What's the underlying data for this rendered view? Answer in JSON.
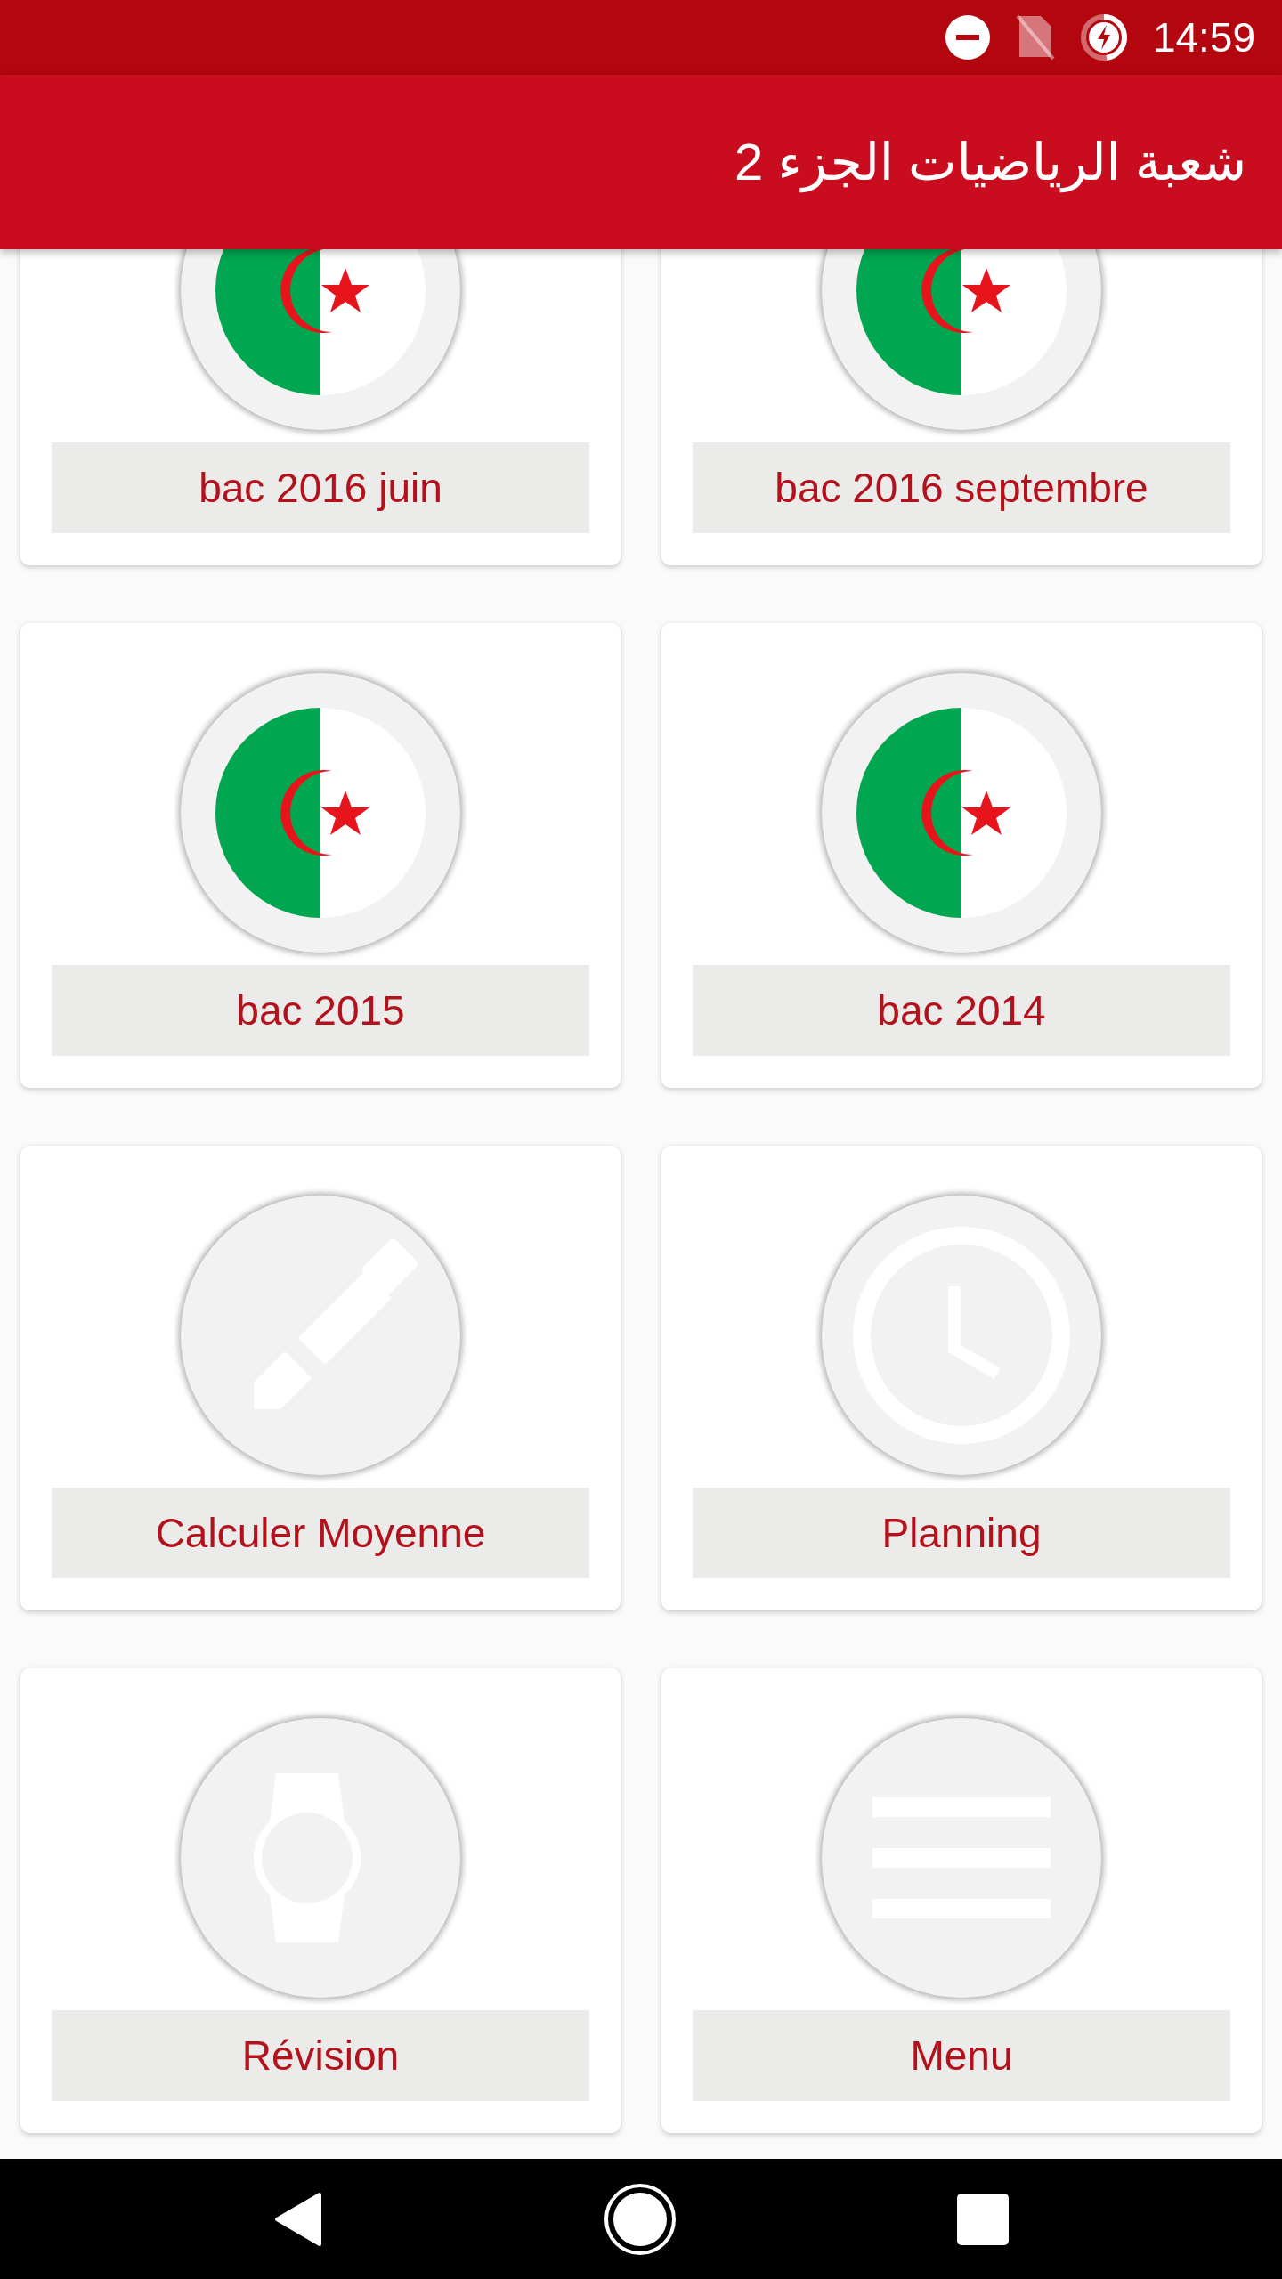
{
  "status_bar": {
    "time": "14:59"
  },
  "app_bar": {
    "title": "شعبة الرياضيات الجزء 2"
  },
  "tiles": [
    {
      "kind": "flag",
      "label": "bac 2016 juin"
    },
    {
      "kind": "flag",
      "label": "bac 2016 septembre"
    },
    {
      "kind": "flag",
      "label": "bac 2015"
    },
    {
      "kind": "flag",
      "label": "bac 2014"
    },
    {
      "kind": "pencil",
      "label": "Calculer Moyenne"
    },
    {
      "kind": "clock",
      "label": "Planning"
    },
    {
      "kind": "watch",
      "label": "Révision"
    },
    {
      "kind": "menu",
      "label": "Menu"
    }
  ]
}
